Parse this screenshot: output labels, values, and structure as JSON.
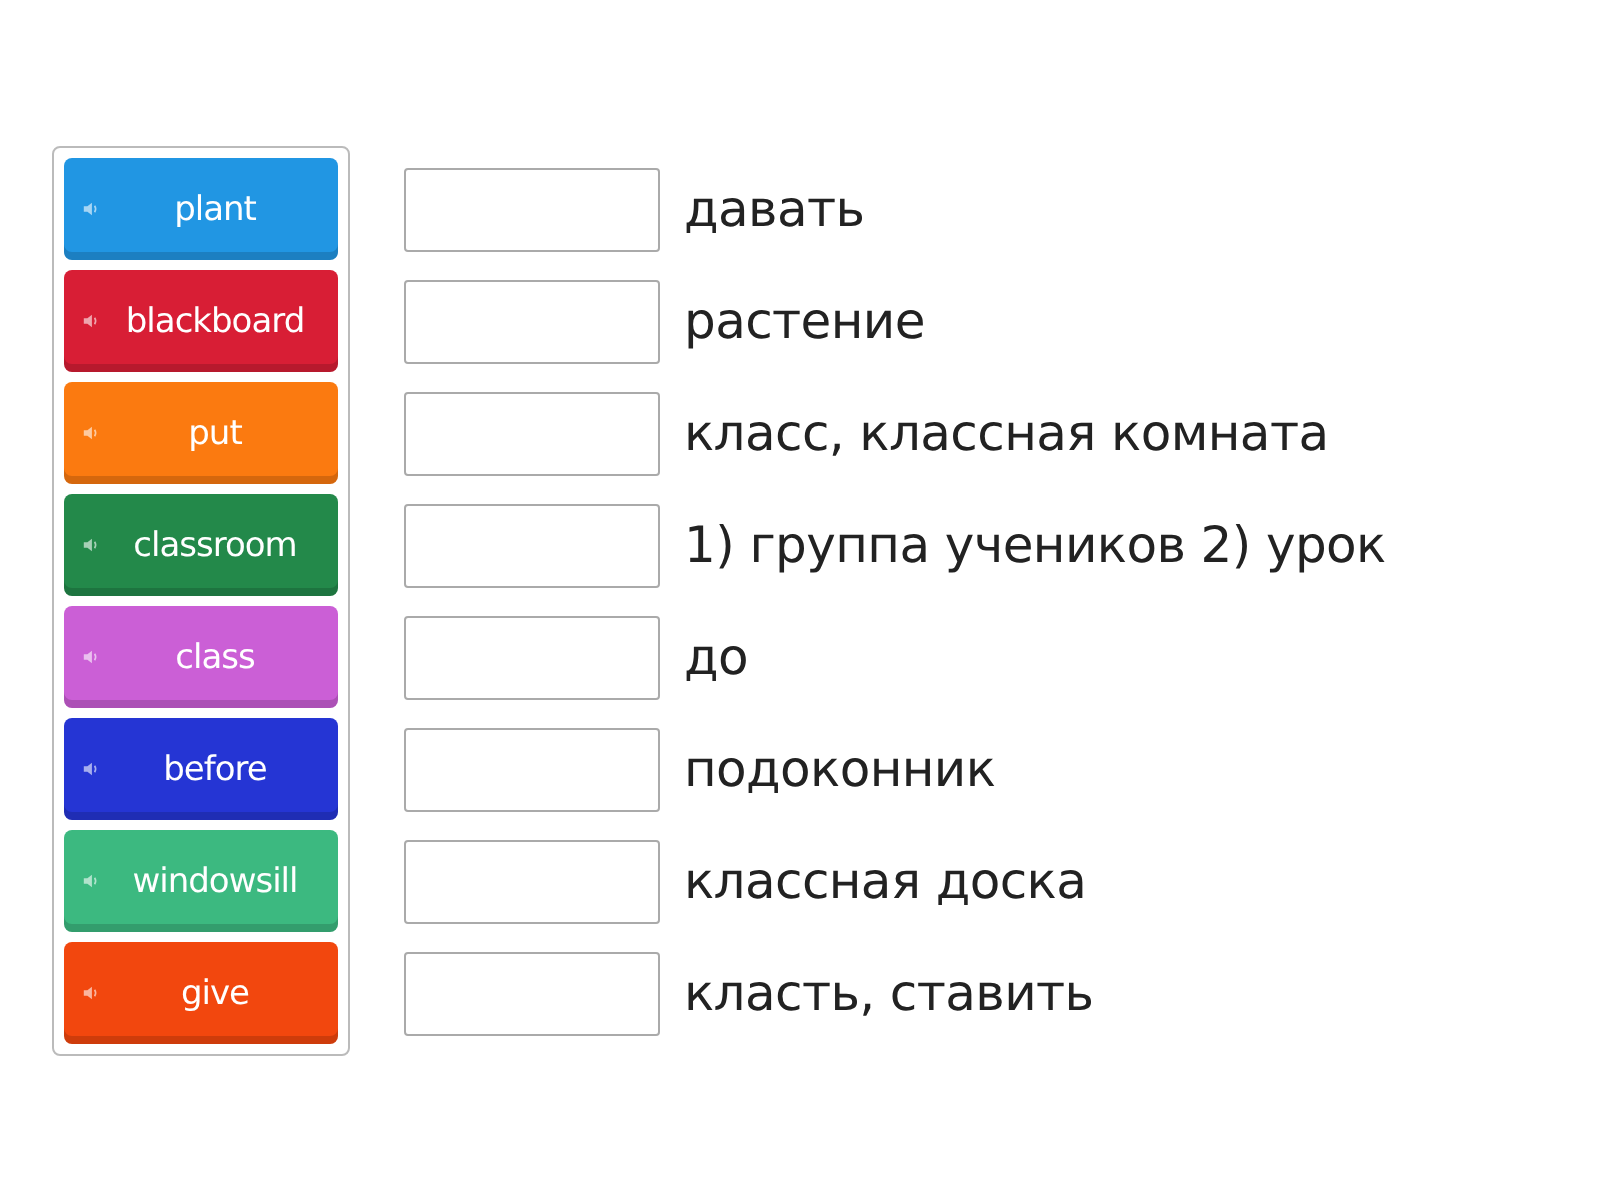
{
  "cards": [
    {
      "label": "plant",
      "color": "#2196e3"
    },
    {
      "label": "blackboard",
      "color": "#d81e35"
    },
    {
      "label": "put",
      "color": "#fb7a10"
    },
    {
      "label": "classroom",
      "color": "#23894a"
    },
    {
      "label": "class",
      "color": "#cb5fd6"
    },
    {
      "label": "before",
      "color": "#2535d4"
    },
    {
      "label": "windowsill",
      "color": "#3cb980"
    },
    {
      "label": "give",
      "color": "#f2470e"
    }
  ],
  "definitions": [
    {
      "text": "давать"
    },
    {
      "text": "растение"
    },
    {
      "text": "класс, классная комната"
    },
    {
      "text": "1) группа учеников 2) урок"
    },
    {
      "text": "до"
    },
    {
      "text": "подоконник"
    },
    {
      "text": "классная доска"
    },
    {
      "text": "класть, ставить"
    }
  ]
}
